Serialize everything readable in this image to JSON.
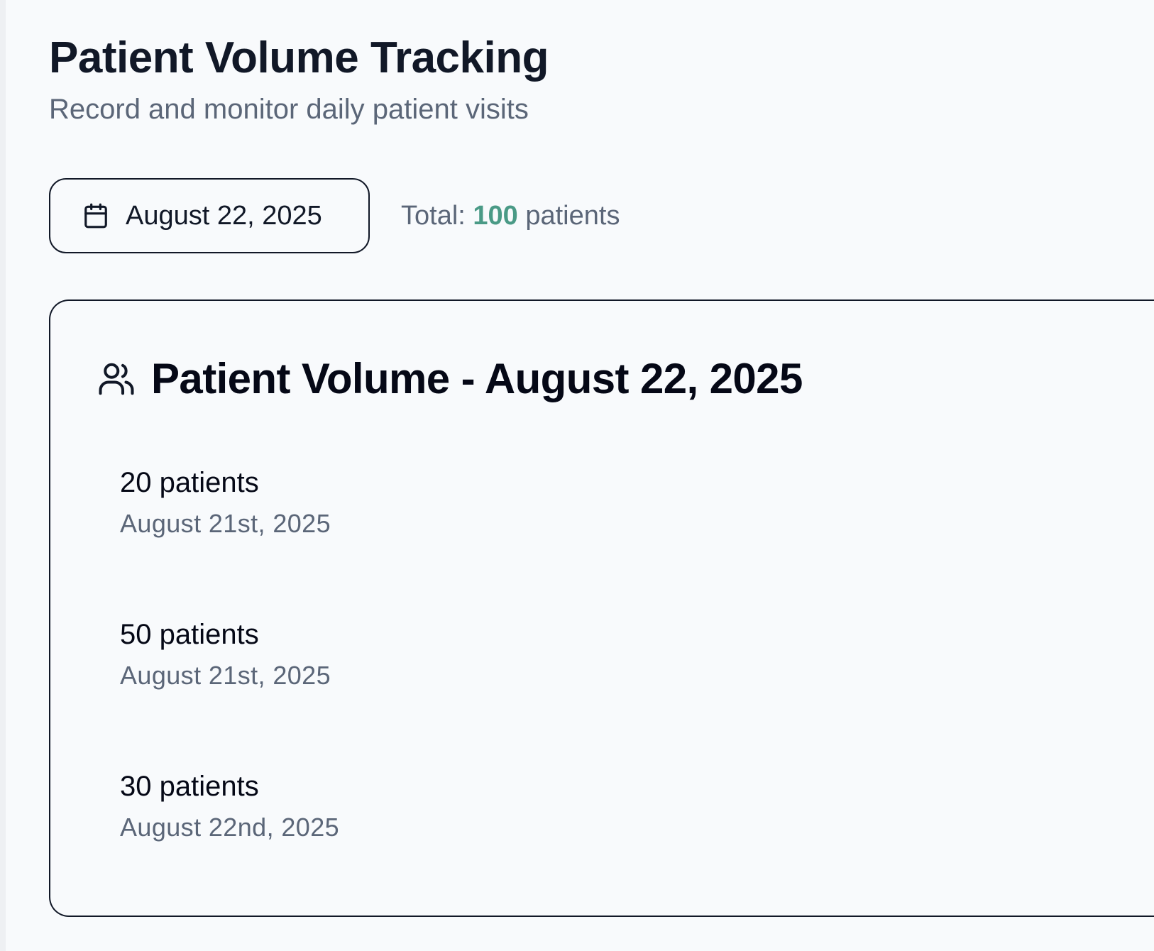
{
  "header": {
    "title": "Patient Volume Tracking",
    "subtitle": "Record and monitor daily patient visits"
  },
  "controls": {
    "selected_date": "August 22, 2025",
    "total_prefix": "Total: ",
    "total_count": "100",
    "total_suffix": " patients"
  },
  "card": {
    "title": "Patient Volume - August 22, 2025",
    "icon": "users-icon"
  },
  "visits": [
    {
      "count_label": "20 patients",
      "date": "August 21st, 2025"
    },
    {
      "count_label": "50 patients",
      "date": "August 21st, 2025"
    },
    {
      "count_label": "30 patients",
      "date": "August 22nd, 2025"
    }
  ],
  "colors": {
    "background": "#f8fafc",
    "primary_text": "#111827",
    "secondary_text": "#5b6678",
    "accent_total": "#4a9a86",
    "border": "#111827"
  },
  "icons": {
    "date_picker": "calendar-icon",
    "card_header": "users-icon"
  }
}
